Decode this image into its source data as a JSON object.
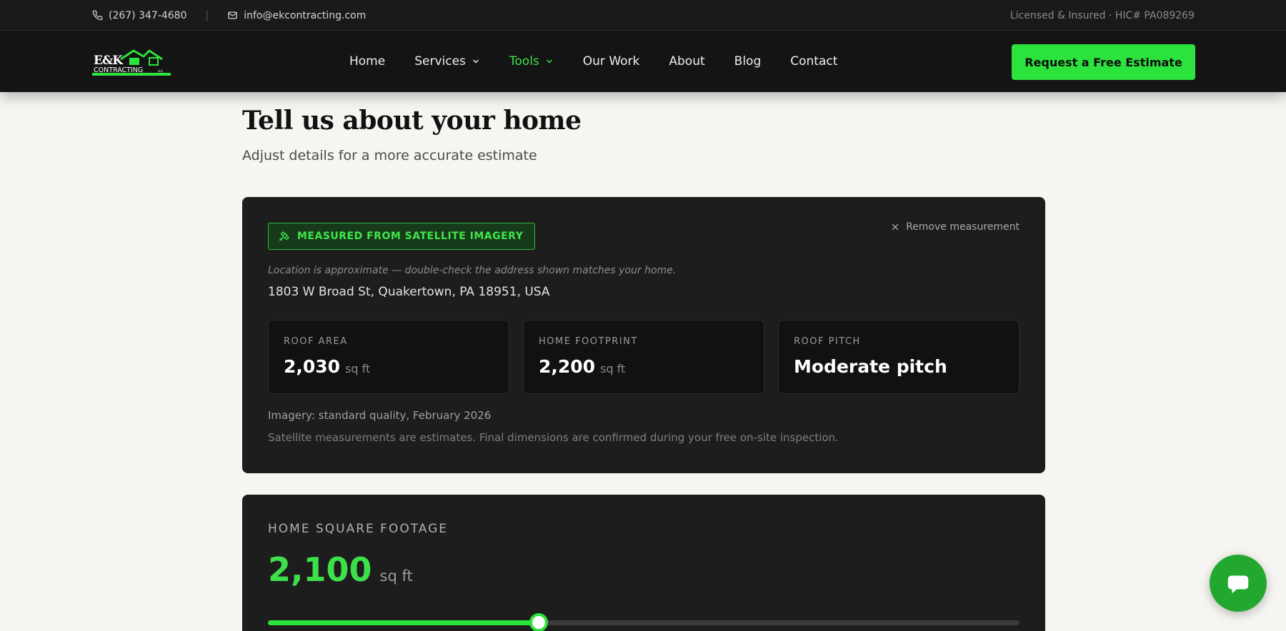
{
  "topbar": {
    "phone": "(267) 347-4680",
    "email": "info@ekcontracting.com",
    "license": "Licensed & Insured · HIC# PA089269"
  },
  "logo": {
    "line1": "E&K",
    "line2": "CONTRACTING",
    "suffix": "LLC"
  },
  "nav": {
    "home": "Home",
    "services": "Services",
    "tools": "Tools",
    "our_work": "Our Work",
    "about": "About",
    "blog": "Blog",
    "contact": "Contact",
    "active": "Tools"
  },
  "cta": {
    "label": "Request a Free Estimate"
  },
  "page": {
    "title": "Tell us about your home",
    "subtitle": "Adjust details for a more accurate estimate"
  },
  "measurement": {
    "badge": "MEASURED FROM SATELLITE IMAGERY",
    "remove_label": "Remove measurement",
    "location_note": "Location is approximate — double-check the address shown matches your home.",
    "address": "1803 W Broad St, Quakertown, PA 18951, USA",
    "stats": [
      {
        "label": "ROOF AREA",
        "value": "2,030",
        "unit": "sq ft"
      },
      {
        "label": "HOME FOOTPRINT",
        "value": "2,200",
        "unit": "sq ft"
      },
      {
        "label": "ROOF PITCH",
        "value": "Moderate pitch",
        "unit": ""
      }
    ],
    "imagery": "Imagery: standard quality, February 2026",
    "disclaimer": "Satellite measurements are estimates. Final dimensions are confirmed during your free on-site inspection."
  },
  "square_footage": {
    "label": "HOME SQUARE FOOTAGE",
    "value": "2,100",
    "unit": "sq ft",
    "slider_fraction": 0.36
  },
  "colors": {
    "accent": "#2ce23c",
    "accent_text": "#3ee04a",
    "dark_bg": "#1d1d1d",
    "page_bg": "#f6f5f2"
  },
  "icons": {
    "phone": "phone-icon",
    "email": "mail-icon",
    "chevron": "chevron-down-icon",
    "satellite": "satellite-icon",
    "close": "close-icon",
    "chat": "chat-bubble-icon"
  }
}
